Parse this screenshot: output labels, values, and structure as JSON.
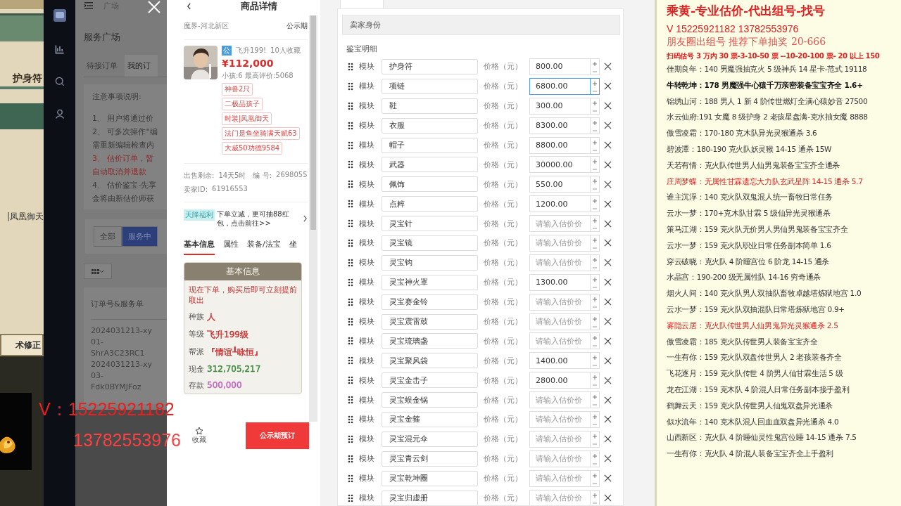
{
  "game": {
    "labels": [
      "护身符",
      "|凤凰御天",
      "术修正"
    ]
  },
  "sidebar": {
    "icons": [
      {
        "kind": "logo"
      },
      {
        "kind": "chart"
      },
      {
        "kind": "search"
      },
      {
        "kind": "user"
      }
    ]
  },
  "background_app": {
    "breadcrumb": "广场",
    "title": "服务广场",
    "tabs": [
      {
        "label": "待接订单",
        "selected": false
      },
      {
        "label": "我的订",
        "selected": true
      }
    ],
    "notes_title": "注意事项说明:",
    "notes": [
      {
        "text": "1、 用户将通过价",
        "kind": "normal"
      },
      {
        "text": "2、 可多次操作\"编",
        "kind": "normal"
      },
      {
        "text": "需重新编辑检查内",
        "kind": "normal"
      },
      {
        "text": "3、 估价订单，暂",
        "kind": "warning"
      },
      {
        "text": "自动取消并退款",
        "kind": "warning"
      },
      {
        "text": "4、 估价鉴宝-先享",
        "kind": "normal"
      },
      {
        "text": "金将由新估价师获",
        "kind": "normal"
      }
    ],
    "filters": [
      {
        "label": "全部",
        "selected": false
      },
      {
        "label": "服务中",
        "selected": true
      }
    ],
    "table": {
      "column": "订单号&服务单",
      "cells": [
        "2024031213-xy",
        "01-",
        "ShrA3C23RC1",
        "2024031213-xy",
        "03-",
        "Fdk0BYMJFoz"
      ]
    }
  },
  "overlay_contact": [
    "V：15225921182",
    "13782553976"
  ],
  "product": {
    "title": "商品详情",
    "server": "魔界-河北新区",
    "status": "公示期",
    "badge": "公",
    "level": "飞升199!",
    "favorites": "10人收藏",
    "price": "¥112,000",
    "stats": "小孩:6 最高评价:5068",
    "tags": [
      "神兽2只",
      "二极品孩子",
      "时装|凤凰御天",
      "法门是鱼坐骑满天赋63",
      "大威50功德9584"
    ],
    "meta": [
      {
        "label": "出售剩余:",
        "value": "14天5时"
      },
      {
        "label": "编 号:",
        "value": "2698055"
      },
      {
        "label": "卖家ID:",
        "value": "61916553"
      }
    ],
    "promo": {
      "badge": "天降福利",
      "text": "下单立减，更可抽88红包，点击前往>>"
    },
    "tabs": [
      {
        "label": "基本信息",
        "selected": true
      },
      {
        "label": "属性",
        "selected": false
      },
      {
        "label": "装备/法宝",
        "selected": false
      },
      {
        "label": "坐",
        "selected": false
      }
    ],
    "card": {
      "title": "基本信息",
      "notice": "现在下单，购买后即可立刻提前取出",
      "rows": [
        {
          "label": "种族",
          "value": "人",
          "color": "#c83232"
        },
        {
          "label": "等级",
          "value": "飞升199级",
          "color": "#c83232"
        },
        {
          "label": "帮派",
          "value": "『情谊┸咏恒』",
          "color": "#c83232"
        },
        {
          "label": "现金",
          "value": "312,705,217",
          "color": "#3a8a3a"
        },
        {
          "label": "存款",
          "value": "500,000",
          "color": "#c060c0"
        }
      ]
    },
    "favorite_label": "收藏",
    "order_button": "公示期预订"
  },
  "form": {
    "section": "卖家身份",
    "subtitle": "鉴宝明细",
    "rows": [
      {
        "label": "模块",
        "name": "护身符",
        "price_label": "价格（元）",
        "value": "800.00",
        "focused": false
      },
      {
        "label": "模块",
        "name": "项链",
        "price_label": "价格（元）",
        "value": "6800.00",
        "focused": true
      },
      {
        "label": "模块",
        "name": "鞋",
        "price_label": "价格（元）",
        "value": "300.00",
        "focused": false
      },
      {
        "label": "模块",
        "name": "衣服",
        "price_label": "价格（元）",
        "value": "8300.00",
        "focused": false
      },
      {
        "label": "模块",
        "name": "帽子",
        "price_label": "价格（元）",
        "value": "8800.00",
        "focused": false
      },
      {
        "label": "模块",
        "name": "武器",
        "price_label": "价格（元）",
        "value": "30000.00",
        "focused": false
      },
      {
        "label": "模块",
        "name": "佩饰",
        "price_label": "价格（元）",
        "value": "550.00",
        "focused": false
      },
      {
        "label": "模块",
        "name": "点粹",
        "price_label": "价格（元）",
        "value": "1200.00",
        "focused": false
      },
      {
        "label": "模块",
        "name": "灵宝针",
        "price_label": "价格（元）",
        "placeholder": "请输入估价价",
        "focused": false
      },
      {
        "label": "模块",
        "name": "灵宝镜",
        "price_label": "价格（元）",
        "placeholder": "请输入估价价",
        "focused": false
      },
      {
        "label": "模块",
        "name": "灵宝钩",
        "price_label": "价格（元）",
        "placeholder": "请输入估价价",
        "focused": false
      },
      {
        "label": "模块",
        "name": "灵宝神火罩",
        "price_label": "价格（元）",
        "value": "1300.00",
        "focused": false
      },
      {
        "label": "模块",
        "name": "灵宝赛金铃",
        "price_label": "价格（元）",
        "placeholder": "请输入估价价",
        "focused": false
      },
      {
        "label": "模块",
        "name": "灵宝震雷鼓",
        "price_label": "价格（元）",
        "placeholder": "请输入估价价",
        "focused": false
      },
      {
        "label": "模块",
        "name": "灵宝琉璃盏",
        "price_label": "价格（元）",
        "placeholder": "请输入估价价",
        "focused": false
      },
      {
        "label": "模块",
        "name": "灵宝聚风袋",
        "price_label": "价格（元）",
        "value": "1400.00",
        "focused": false
      },
      {
        "label": "模块",
        "name": "灵宝金击子",
        "price_label": "价格（元）",
        "value": "2800.00",
        "focused": false
      },
      {
        "label": "模块",
        "name": "灵宝蜈金锅",
        "price_label": "价格（元）",
        "placeholder": "请输入估价价",
        "focused": false
      },
      {
        "label": "模块",
        "name": "灵宝金箍",
        "price_label": "价格（元）",
        "placeholder": "请输入估价价",
        "focused": false
      },
      {
        "label": "模块",
        "name": "灵宝混元伞",
        "price_label": "价格（元）",
        "placeholder": "请输入估价价",
        "focused": false
      },
      {
        "label": "模块",
        "name": "灵宝青云剑",
        "price_label": "价格（元）",
        "placeholder": "请输入估价价",
        "focused": false
      },
      {
        "label": "模块",
        "name": "灵宝乾坤圈",
        "price_label": "价格（元）",
        "placeholder": "请输入估价价",
        "focused": false
      },
      {
        "label": "模块",
        "name": "灵宝归虚册",
        "price_label": "价格（元）",
        "placeholder": "请输入估价价",
        "focused": false
      }
    ]
  },
  "notes_panel": {
    "header": [
      {
        "text": "乘黄-专业估价-代出组号-找号",
        "kind": "title"
      },
      {
        "text": "V   15225921182   13782553976",
        "kind": "contact"
      },
      {
        "text": "朋友圈出组号  推荐下单抽奖 20-666",
        "kind": "promo"
      },
      {
        "text": "扫码估号 3 万内 30 票-3-10-50 票  --10-20-100 票- 20 以上 150",
        "kind": "pricing"
      }
    ],
    "lines": [
      {
        "text": "佳期良年：140 男魔强抽克火 5 级神兵 14 星卡-范式 19118",
        "kind": "normal"
      },
      {
        "text": "牛转乾坤：178 男魔强牛心猿千万亲密装备宝宝齐全 1.6+",
        "kind": "bold"
      },
      {
        "text": "锦绣山河：188 男人 1 新 4 阶传世燃灯全满心猿妙音 27500",
        "kind": "normal"
      },
      {
        "text": "水云仙府:191 女魔 8 级护身 2 老孩星盘满-克水抽女魔 8888",
        "kind": "normal"
      },
      {
        "text": "傲雪凌霜：170-180 克木队异光灵猴通杀 3.6",
        "kind": "normal"
      },
      {
        "text": "碧波潭：180-190 克火队妖灵猴 14-15 通杀 15W",
        "kind": "normal"
      },
      {
        "text": "天若有情：克火队传世男人仙男鬼装备宝宝齐全通杀",
        "kind": "normal"
      },
      {
        "text": "庄周梦蝶：无属性甘霖遗忘大力队玄武星阵 14-15 通杀 5.7",
        "kind": "highlight"
      },
      {
        "text": "谁主沉浮：140 克火队双鬼混人统一畜牧日常任务",
        "kind": "normal"
      },
      {
        "text": "云水一梦：170+克木队甘霖 5 级仙异光灵猴通杀",
        "kind": "normal"
      },
      {
        "text": "策马江湖：159 克火队无价男人男仙男鬼装备宝宝齐全",
        "kind": "normal"
      },
      {
        "text": "云水一梦：159 克火队职业日常任务副本简单 1.6",
        "kind": "normal"
      },
      {
        "text": "穿云破晓：克火队 4 阶睡宫位 6 阶龙 14-15 通杀",
        "kind": "normal"
      },
      {
        "text": "水晶宫：190-200 级无属性队 14-16 穷奇通杀",
        "kind": "normal"
      },
      {
        "text": "烟火人间：140 克火队男人双抽队畜牧卓越塔炼狱地宫 1.0",
        "kind": "normal"
      },
      {
        "text": "云水一梦：159 克火队双抽混队日常塔炼狱地宫 0.9+",
        "kind": "normal"
      },
      {
        "text": "雾隐云居：克火队传世男人仙男鬼异光灵猴通杀 2.5",
        "kind": "highlight"
      },
      {
        "text": "傲雪凌霜：185 克火队传世男人装备宝宝齐全",
        "kind": "normal"
      },
      {
        "text": "一生有你：159 克火队双盘传世男人 2 老孩装备齐全",
        "kind": "normal"
      },
      {
        "text": "飞花逐月：159 克火队传世 4 阶男人仙甘霖生活 5 级",
        "kind": "normal"
      },
      {
        "text": "龙在江湖：159 克木队 4 阶混人日常任务副本接手盈利",
        "kind": "normal"
      },
      {
        "text": "鹤舞云天：159 克火队传世男人仙鬼双盘异光通杀",
        "kind": "normal"
      },
      {
        "text": "似水流年：140 克木队混人回血血双盘异光通杀 4.0",
        "kind": "normal"
      },
      {
        "text": "山西新区：克火队 4 阶睡仙灵性鬼宫位睡 14-15 通杀 7.5",
        "kind": "normal"
      },
      {
        "text": "一生有你：克火队 4 阶混人装备宝宝齐全上手盈利",
        "kind": "normal"
      }
    ]
  }
}
